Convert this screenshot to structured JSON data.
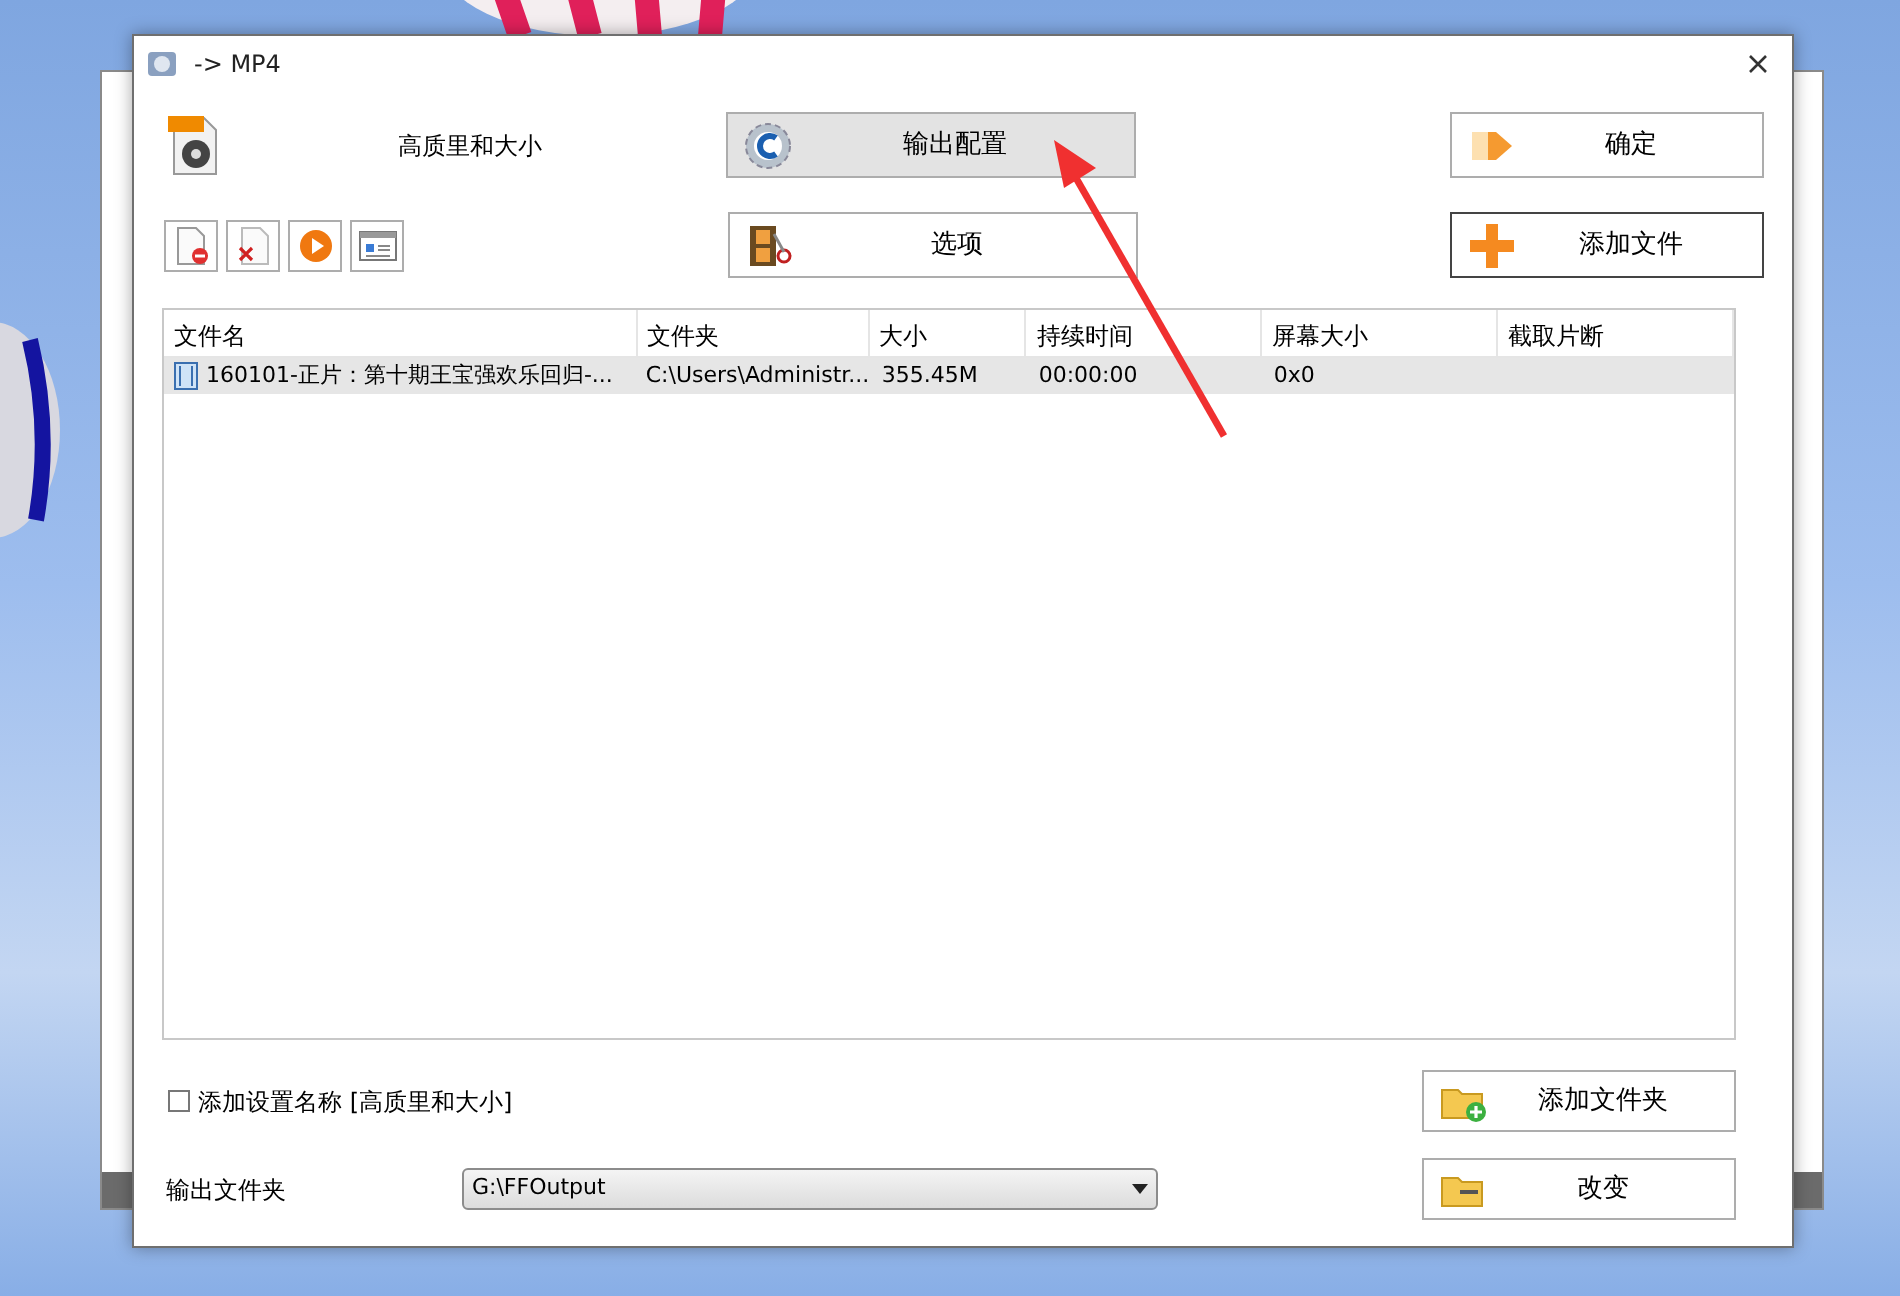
{
  "window": {
    "title": "-> MP4"
  },
  "profile": {
    "label": "高质里和大小"
  },
  "buttons": [
    {
      "label": "输出配置",
      "kind": "config",
      "highlighted": true,
      "focused": false
    },
    {
      "label": "确定",
      "kind": "ok",
      "highlighted": false,
      "focused": false
    },
    {
      "label": "选项",
      "kind": "options",
      "highlighted": false,
      "focused": false
    },
    {
      "label": "添加文件",
      "kind": "add",
      "highlighted": false,
      "focused": true
    }
  ],
  "table": {
    "columns": [
      "文件名",
      "文件夹",
      "大小",
      "持续时间",
      "屏幕大小",
      "截取片断"
    ],
    "rows": [
      {
        "cells": [
          "160101-正片：第十期王宝强欢乐回归-...",
          "C:\\Users\\Administr...",
          "355.45M",
          "00:00:00",
          "0x0",
          ""
        ],
        "selected": true
      }
    ]
  },
  "name_option": {
    "label": "添加设置名称 [高质里和大小]",
    "checked": false
  },
  "add_folder_button": {
    "label": "添加文件夹"
  },
  "output_folder": {
    "label": "输出文件夹",
    "value": "G:\\FFOutput"
  },
  "change_button": {
    "label": "改变"
  }
}
